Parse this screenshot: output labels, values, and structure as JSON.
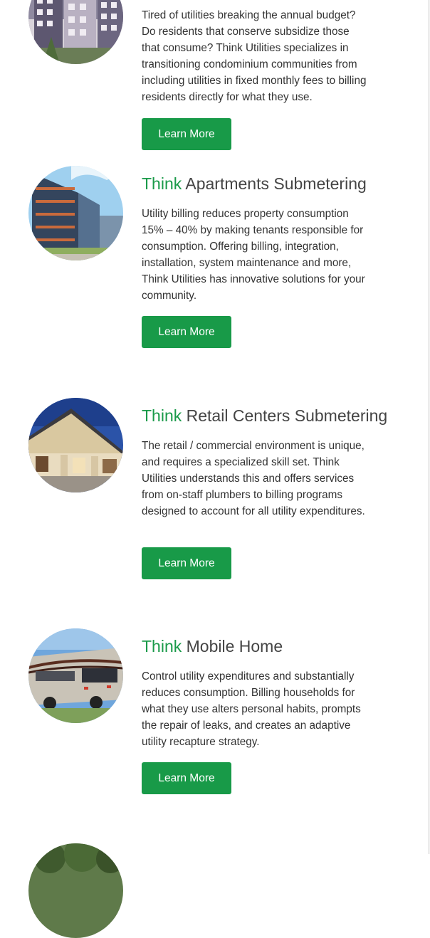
{
  "brand": {
    "accent": "#1a9a49",
    "button_bg": "#189a48"
  },
  "services": [
    {
      "image_icon": "condominium-building-photo",
      "prefix": "",
      "title": "",
      "description": "Tired of utilities breaking the annual budget? Do residents that conserve subsidize those that consume? Think Utilities specializes in transitioning condominium communities from including utilities in fixed monthly fees to billing residents directly for what they use.",
      "button_label": "Learn More"
    },
    {
      "image_icon": "apartment-building-photo",
      "prefix": "Think",
      "title": "Apartments Submetering",
      "description": "Utility billing reduces property consumption 15% – 40% by making tenants responsible for consumption. Offering billing, integration, installation, system maintenance and more, Think Utilities has innovative solutions for your community.",
      "button_label": "Learn More"
    },
    {
      "image_icon": "retail-center-photo",
      "prefix": "Think",
      "title": "Retail Centers Submetering",
      "description": "The retail / commercial environment is unique, and requires a specialized skill set. Think Utilities understands this and offers services from on-staff plumbers to billing programs designed to account for all utility expenditures.",
      "button_label": "Learn More"
    },
    {
      "image_icon": "mobile-home-rv-photo",
      "prefix": "Think",
      "title": "Mobile Home",
      "description": "Control utility expenditures and substantially reduces consumption. Billing households for what they use alters personal habits, prompts the repair of leaks, and creates an adaptive utility recapture strategy.",
      "button_label": "Learn More"
    }
  ],
  "next_item": {
    "image_icon": "trees-photo"
  }
}
